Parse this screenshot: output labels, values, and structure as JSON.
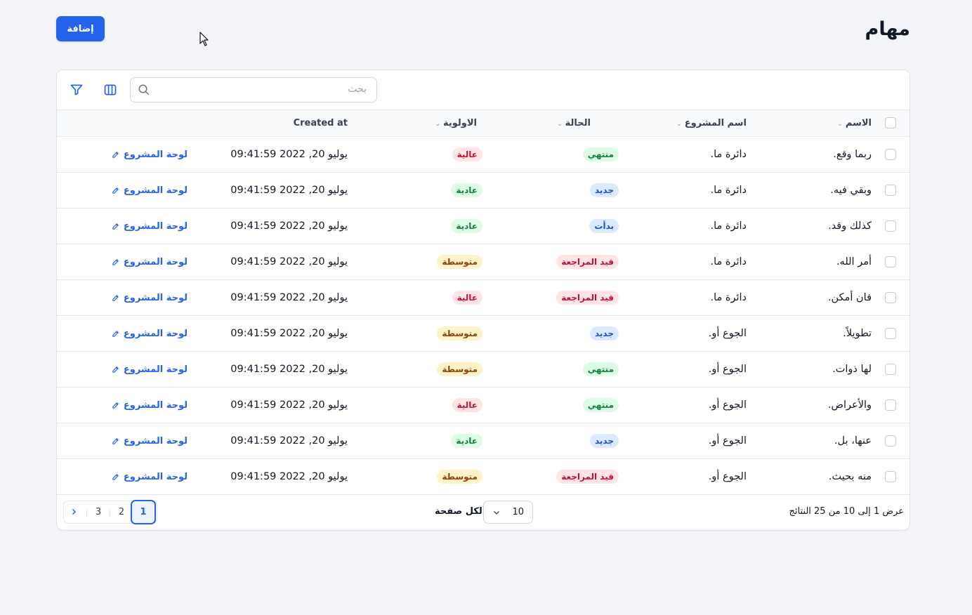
{
  "header": {
    "title": "مهام",
    "add_label": "إضافة"
  },
  "toolbar": {
    "search_placeholder": "بحث",
    "search_value": ""
  },
  "table": {
    "columns": {
      "name": "الاسم",
      "project": "اسم المشروع",
      "status": "الحالة",
      "priority": "الاولوية",
      "created_at": "Created at"
    },
    "rows": [
      {
        "name": "ربما وقع.",
        "project": "دائرة ما.",
        "status": "منتهي",
        "priority": "عالية",
        "created": "يوليو 20, 2022 09:41:59",
        "link": "لوحة المشروع"
      },
      {
        "name": "وبقي فيه.",
        "project": "دائرة ما.",
        "status": "جديد",
        "priority": "عادية",
        "created": "يوليو 20, 2022 09:41:59",
        "link": "لوحة المشروع"
      },
      {
        "name": "كذلك وقد.",
        "project": "دائرة ما.",
        "status": "بدأت",
        "priority": "عادية",
        "created": "يوليو 20, 2022 09:41:59",
        "link": "لوحة المشروع"
      },
      {
        "name": "أمر الله.",
        "project": "دائرة ما.",
        "status": "قيد المراجعة",
        "priority": "متوسطة",
        "created": "يوليو 20, 2022 09:41:59",
        "link": "لوحة المشروع"
      },
      {
        "name": "فان أمكن.",
        "project": "دائرة ما.",
        "status": "قيد المراجعة",
        "priority": "عالية",
        "created": "يوليو 20, 2022 09:41:59",
        "link": "لوحة المشروع"
      },
      {
        "name": "تطويلاً.",
        "project": "الجوع أو.",
        "status": "جديد",
        "priority": "متوسطة",
        "created": "يوليو 20, 2022 09:41:59",
        "link": "لوحة المشروع"
      },
      {
        "name": "لها ذوات.",
        "project": "الجوع أو.",
        "status": "منتهي",
        "priority": "متوسطة",
        "created": "يوليو 20, 2022 09:41:59",
        "link": "لوحة المشروع"
      },
      {
        "name": "والأعراض.",
        "project": "الجوع أو.",
        "status": "منتهي",
        "priority": "عالية",
        "created": "يوليو 20, 2022 09:41:59",
        "link": "لوحة المشروع"
      },
      {
        "name": "عنها، بل.",
        "project": "الجوع أو.",
        "status": "جديد",
        "priority": "عادية",
        "created": "يوليو 20, 2022 09:41:59",
        "link": "لوحة المشروع"
      },
      {
        "name": "منه بحيث.",
        "project": "الجوع أو.",
        "status": "قيد المراجعة",
        "priority": "متوسطة",
        "created": "يوليو 20, 2022 09:41:59",
        "link": "لوحة المشروع"
      }
    ]
  },
  "badge_colors": {
    "منتهي": {
      "bg": "#dcfce7",
      "fg": "#15803d"
    },
    "جديد": {
      "bg": "#dbeafe",
      "fg": "#1d4ed8"
    },
    "بدأت": {
      "bg": "#dbeafe",
      "fg": "#1d4ed8"
    },
    "قيد المراجعة": {
      "bg": "#ffe4e6",
      "fg": "#be123c"
    },
    "عالية": {
      "bg": "#ffe4e6",
      "fg": "#be123c"
    },
    "عادية": {
      "bg": "#dcfce7",
      "fg": "#15803d"
    },
    "متوسطة": {
      "bg": "#fef3c7",
      "fg": "#92400e"
    }
  },
  "footer": {
    "results_text": "عرض 1 إلى 10 من 25 النتائج",
    "per_page_value": "10",
    "per_page_label": "لكل صفحة",
    "pages": [
      "1",
      "2",
      "3"
    ],
    "current_page": "1"
  },
  "colors": {
    "accent": "#2563eb",
    "background": "#f3f4f7"
  }
}
